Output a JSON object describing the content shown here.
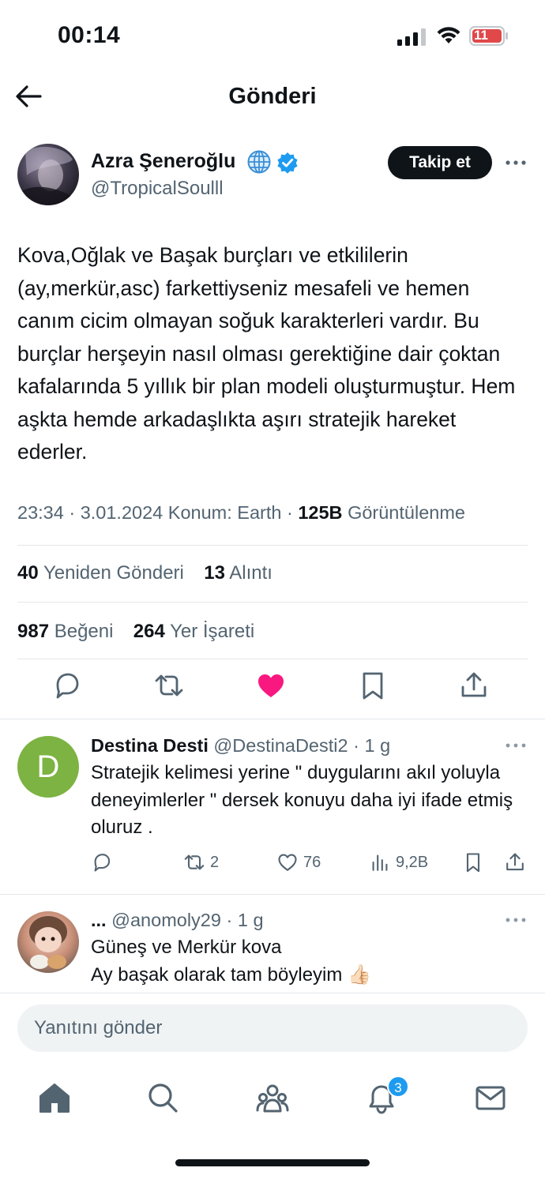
{
  "status_bar": {
    "time": "00:14",
    "battery": "11"
  },
  "header": {
    "title": "Gönderi"
  },
  "post": {
    "author_name": "Azra Şeneroğlu",
    "handle": "@TropicalSoulll",
    "follow_label": "Takip et",
    "text": "Kova,Oğlak ve Başak burçları ve etkililerin (ay,merkür,asc) farkettiyseniz mesafeli ve hemen canım cicim olmayan soğuk karakterleri vardır. Bu burçlar herşeyin nasıl olması gerektiğine dair çoktan kafalarında 5 yıllık bir plan modeli oluşturmuştur. Hem aşkta hemde arkadaşlıkta aşırı stratejik hareket ederler.",
    "meta_prefix": "23:34 · 3.01.2024 Konum: Earth · ",
    "views_count": "125B",
    "views_label": "Görüntülenme",
    "reposts_count": "40",
    "reposts_label": "Yeniden Gönderi",
    "quotes_count": "13",
    "quotes_label": "Alıntı",
    "likes_count": "987",
    "likes_label": "Beğeni",
    "bookmarks_count": "264",
    "bookmarks_label": "Yer İşareti",
    "heart_color": "#f91880"
  },
  "replies": [
    {
      "avatar_letter": "D",
      "name": "Destina Desti",
      "handle": "@DestinaDesti2",
      "time": "· 1 g",
      "text": "Stratejik kelimesi yerine \" duygularını akıl yoluyla deneyimlerler \" dersek konuyu daha iyi ifade etmiş oluruz .",
      "retweets": "2",
      "likes": "76",
      "views": "9,2B"
    },
    {
      "name": "...",
      "handle": "@anomoly29",
      "time": "· 1 g",
      "line1": "Güneş ve Merkür kova",
      "line2": "Ay başak olarak tam böyleyim 👍🏻"
    }
  ],
  "compose": {
    "placeholder": "Yanıtını gönder"
  },
  "nav": {
    "notifications_badge": "3"
  },
  "accent_color": "#1d9bf0"
}
